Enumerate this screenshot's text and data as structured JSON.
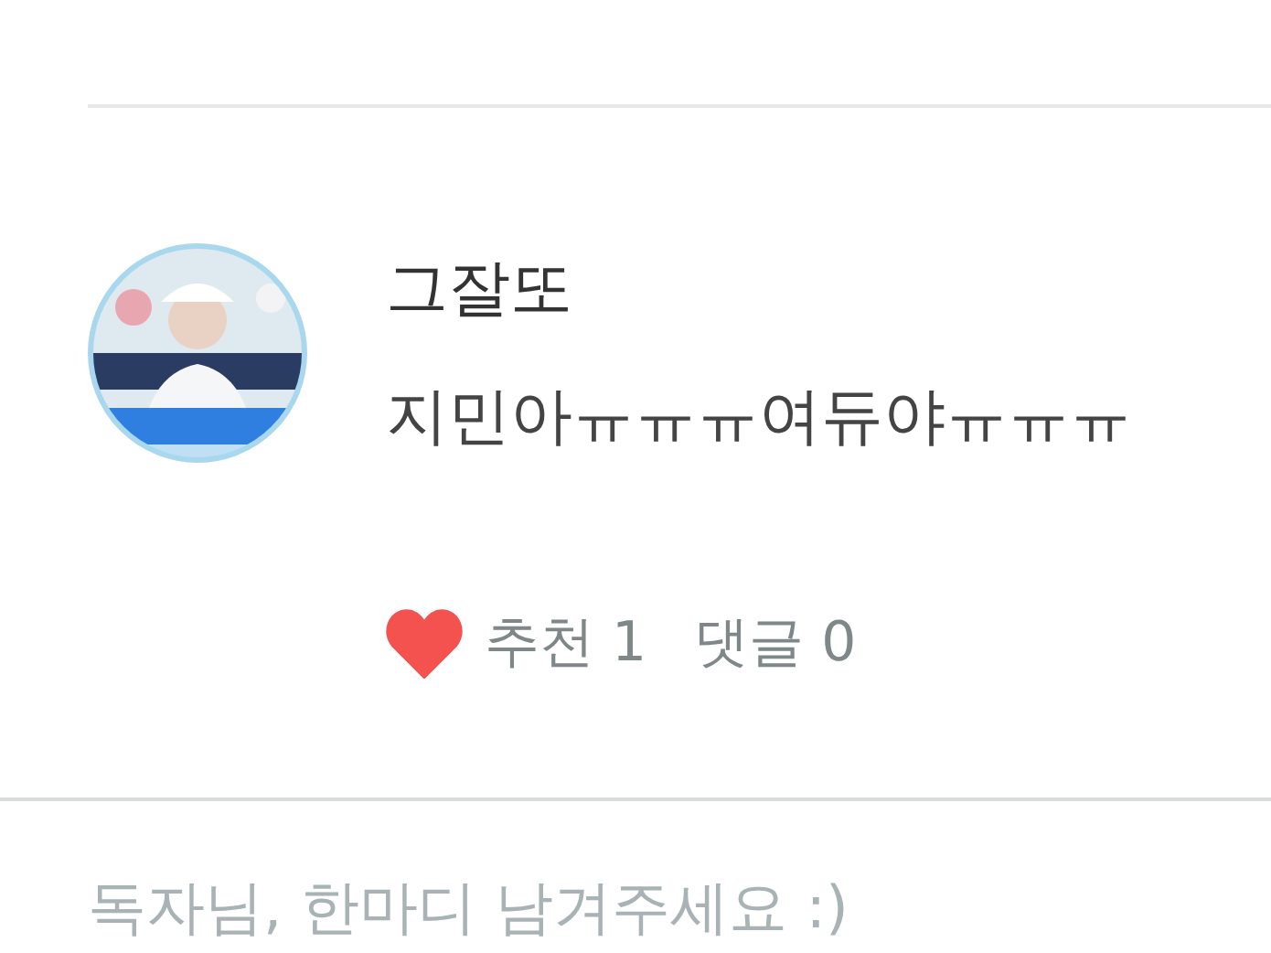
{
  "comment": {
    "author": "그잘또",
    "text": "지민아ㅠㅠㅠ여듀야ㅠㅠㅠ",
    "likes": {
      "label": "추천",
      "count": "1",
      "liked": true
    },
    "replies": {
      "label": "댓글",
      "count": "0"
    }
  },
  "reply_field": {
    "placeholder": "독자님, 한마디 남겨주세요 :)"
  }
}
